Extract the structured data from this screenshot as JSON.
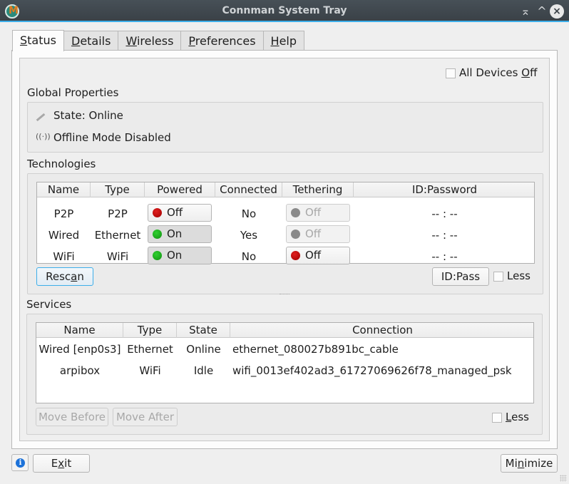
{
  "window": {
    "title": "Connman System Tray",
    "buttons": {
      "keep_above": "⌅",
      "minimize": "^",
      "close": "×"
    }
  },
  "tabs": [
    {
      "label": "Status",
      "mnemonic_index": 0,
      "active": true
    },
    {
      "label": "Details",
      "mnemonic_index": 0,
      "active": false
    },
    {
      "label": "Wireless",
      "mnemonic_index": 0,
      "active": false
    },
    {
      "label": "Preferences",
      "mnemonic_index": 0,
      "active": false
    },
    {
      "label": "Help",
      "mnemonic_index": 0,
      "active": false
    }
  ],
  "status": {
    "all_devices_off": {
      "prefix": "All Devices ",
      "mnemonic": "O",
      "suffix": "ff",
      "checked": false
    },
    "global_properties": {
      "label": "Global Properties",
      "state": {
        "icon": "network-wired-icon",
        "text": "State: Online"
      },
      "offline_mode": {
        "icon": "antenna-icon",
        "text": "Offline Mode Disabled"
      }
    },
    "technologies": {
      "label": "Technologies",
      "columns": [
        "Name",
        "Type",
        "Powered",
        "Connected",
        "Tethering",
        "ID:Password"
      ],
      "rows": [
        {
          "name": "P2P",
          "type": "P2P",
          "powered": {
            "label": "Off",
            "state": "off",
            "enabled": true
          },
          "connected": "No",
          "tethering": {
            "label": "Off",
            "state": "off",
            "enabled": false
          },
          "id_password": "-- : --"
        },
        {
          "name": "Wired",
          "type": "Ethernet",
          "powered": {
            "label": "On",
            "state": "on",
            "enabled": true
          },
          "connected": "Yes",
          "tethering": {
            "label": "Off",
            "state": "off",
            "enabled": false
          },
          "id_password": "-- : --"
        },
        {
          "name": "WiFi",
          "type": "WiFi",
          "powered": {
            "label": "On",
            "state": "on",
            "enabled": true
          },
          "connected": "No",
          "tethering": {
            "label": "Off",
            "state": "off",
            "enabled": true
          },
          "id_password": "-- : --"
        }
      ],
      "rescan": {
        "prefix": "Resc",
        "mnemonic": "a",
        "suffix": "n"
      },
      "id_pass": "ID:Pass",
      "less": {
        "label": "Less",
        "checked": false
      }
    },
    "services": {
      "label": "Services",
      "columns": [
        "Name",
        "Type",
        "State",
        "Connection"
      ],
      "rows": [
        {
          "name": "Wired [enp0s3]",
          "type": "Ethernet",
          "state": "Online",
          "connection": "ethernet_080027b891bc_cable"
        },
        {
          "name": "arpibox",
          "type": "WiFi",
          "state": "Idle",
          "connection": "wifi_0013ef402ad3_61727069626f78_managed_psk"
        }
      ],
      "move_before": "Move Before",
      "move_after": "Move After",
      "less": {
        "mnemonic": "L",
        "suffix": "ess",
        "checked": false
      }
    }
  },
  "footer": {
    "info_icon": "i",
    "exit": {
      "prefix": "E",
      "mnemonic": "x",
      "suffix": "it"
    },
    "minimize": {
      "prefix": "Mi",
      "mnemonic": "n",
      "suffix": "imize"
    }
  },
  "colors": {
    "accent": "#3daee9",
    "on": "#20b020",
    "off": "#c00000",
    "disabled": "#8a8a8a"
  }
}
